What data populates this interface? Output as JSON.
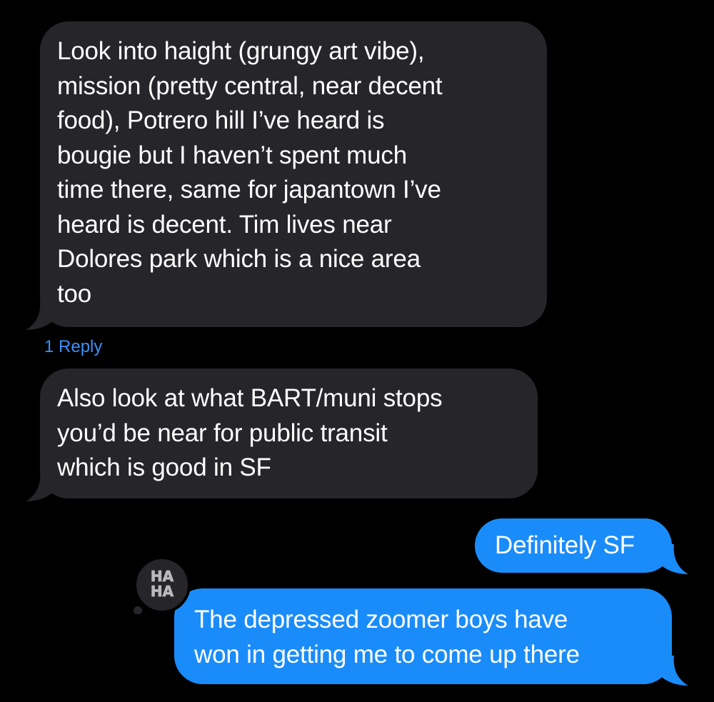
{
  "thread": {
    "messages": [
      {
        "direction": "incoming",
        "text": "Look into haight (grungy art vibe),\nmission (pretty central, near decent\nfood), Potrero hill I’ve heard is\nbougie but I haven’t spent much\ntime there, same for japantown I’ve\nheard is decent. Tim lives near\nDolores park which is a nice area\ntoo"
      },
      {
        "direction": "incoming",
        "text": "Also look at what BART/muni stops\nyou’d be near for public transit\nwhich is good in SF"
      },
      {
        "direction": "outgoing",
        "text": "Definitely SF"
      },
      {
        "direction": "outgoing",
        "text": "The depressed zoomer boys have\nwon in getting me to come up there"
      }
    ],
    "reply_link": "1 Reply",
    "tapback": {
      "type": "haha",
      "label": "HA\nHA"
    }
  },
  "colors": {
    "background": "#000000",
    "incoming_bubble": "#26252a",
    "outgoing_bubble": "#1a8cfa",
    "link": "#3d8ff7",
    "tapback_text": "#b9b9bd"
  }
}
